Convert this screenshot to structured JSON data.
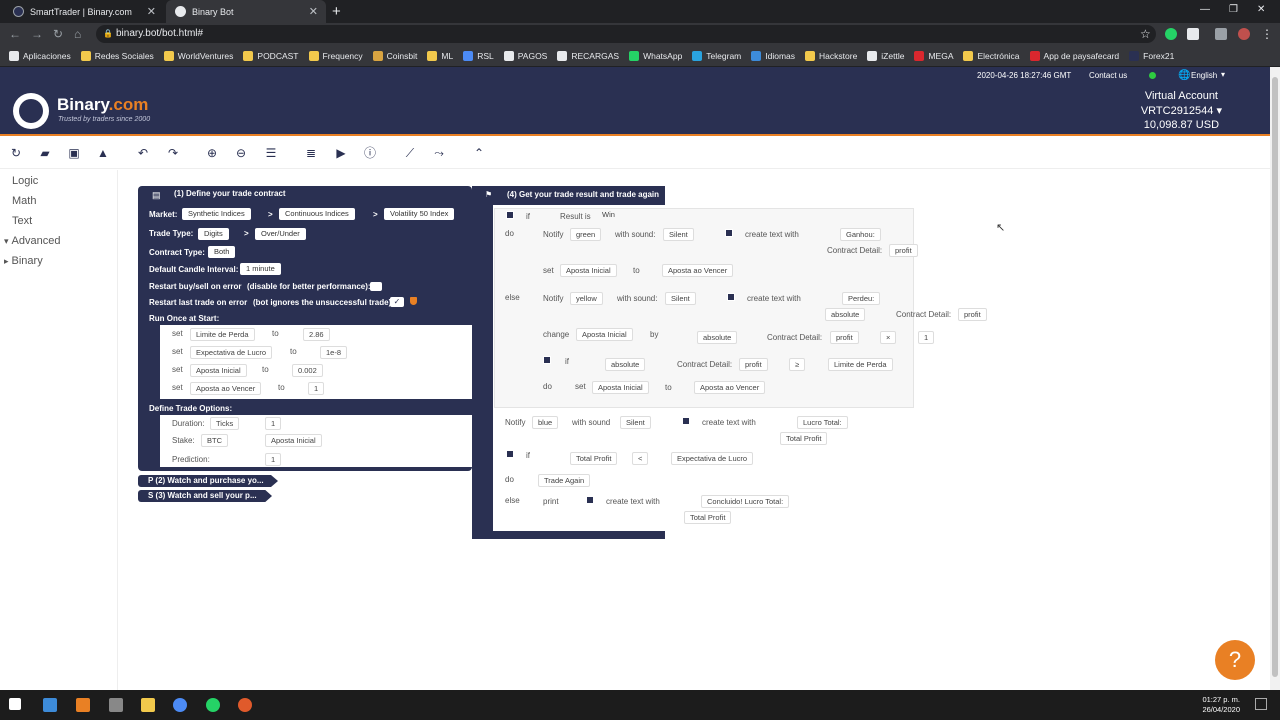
{
  "browser": {
    "tabs": [
      {
        "title": "SmartTrader | Binary.com"
      },
      {
        "title": "Binary Bot"
      }
    ],
    "url": "binary.bot/bot.html#",
    "bookmarks": [
      {
        "label": "Aplicaciones",
        "color": "#e8eaed"
      },
      {
        "label": "Redes Sociales",
        "color": "#f2c94c"
      },
      {
        "label": "WorldVentures",
        "color": "#f2c94c"
      },
      {
        "label": "PODCAST",
        "color": "#f2c94c"
      },
      {
        "label": "Frequency",
        "color": "#f2c94c"
      },
      {
        "label": "Coinsbit",
        "color": "#d9a441"
      },
      {
        "label": "ML",
        "color": "#f2c94c"
      },
      {
        "label": "RSL",
        "color": "#4c8bf5"
      },
      {
        "label": "PAGOS",
        "color": "#e8eaed"
      },
      {
        "label": "RECARGAS",
        "color": "#e8eaed"
      },
      {
        "label": "WhatsApp",
        "color": "#25d366"
      },
      {
        "label": "Telegram",
        "color": "#2aa3df"
      },
      {
        "label": "Idiomas",
        "color": "#3d8bd9"
      },
      {
        "label": "Hackstore",
        "color": "#f2c94c"
      },
      {
        "label": "iZettle",
        "color": "#e8eaed"
      },
      {
        "label": "MEGA",
        "color": "#d9272e"
      },
      {
        "label": "Electrónica",
        "color": "#f2c94c"
      },
      {
        "label": "App de paysafecard",
        "color": "#d9272e"
      },
      {
        "label": "Forex21",
        "color": "#2a3052"
      }
    ]
  },
  "site": {
    "datetime": "2020-04-26 18:27:46 GMT",
    "contact": "Contact us",
    "language": "English",
    "brand_name": "Binary",
    "brand_suffix": ".com",
    "tagline": "Trusted by traders since 2000",
    "account_type": "Virtual Account",
    "account_id": "VRTC2912544",
    "balance": "10,098.87 USD",
    "accent": "#e98024",
    "navy": "#2a3052"
  },
  "toolbox": {
    "categories": [
      {
        "label": "Logic",
        "arrow": ""
      },
      {
        "label": "Math",
        "arrow": ""
      },
      {
        "label": "Text",
        "arrow": ""
      },
      {
        "label": "Advanced",
        "arrow": "▾"
      },
      {
        "label": "Binary",
        "arrow": "▸"
      }
    ]
  },
  "toolbar_icons": [
    "reset-icon",
    "folder-icon",
    "save-icon",
    "drive-icon",
    "undo-icon",
    "redo-icon",
    "zoom-in-icon",
    "zoom-out-icon",
    "sort-icon",
    "list-icon",
    "run-icon",
    "info-icon",
    "chart-icon",
    "tradingview-icon",
    "collapse-icon"
  ],
  "block1": {
    "title": "(1) Define your trade contract",
    "market_label": "Market:",
    "market": [
      "Synthetic Indices",
      "Continuous Indices",
      "Volatility 50 Index"
    ],
    "trade_type_label": "Trade Type:",
    "trade_type": [
      "Digits",
      "Over/Under"
    ],
    "contract_type_label": "Contract Type:",
    "contract_type": "Both",
    "candle_label": "Default Candle Interval:",
    "candle": "1 minute",
    "restart_buy": "Restart buy/sell on error",
    "restart_buy_note": "(disable for better performance):",
    "restart_trade": "Restart last trade on error",
    "restart_trade_note": "(bot ignores the unsuccessful trade):",
    "run_once": "Run Once at Start:",
    "vars": [
      {
        "name": "Limite de Perda",
        "value": "2.86"
      },
      {
        "name": "Expectativa de Lucro",
        "value": "1e-8"
      },
      {
        "name": "Aposta Inicial",
        "value": "0.002"
      },
      {
        "name": "Aposta ao Vencer",
        "value": "1"
      }
    ],
    "set_word": "set",
    "to_word": "to",
    "options": "Define Trade Options:",
    "duration_label": "Duration:",
    "duration_unit": "Ticks",
    "duration_value": "1",
    "stake_label": "Stake:",
    "stake_currency": "BTC",
    "stake_var": "Aposta Inicial",
    "prediction_label": "Prediction:",
    "prediction_value": "1"
  },
  "block2": {
    "title": "P (2) Watch and purchase yo..."
  },
  "block3": {
    "title": "S (3) Watch and sell your p..."
  },
  "block4": {
    "title": "(4) Get your trade result and trade again",
    "if_word": "if",
    "do_word": "do",
    "else_word": "else",
    "result_is": "Result is",
    "win": "Win",
    "notify": "Notify",
    "with_sound": "with sound:",
    "with_sound2": "with sound",
    "silent": "Silent",
    "create_text": "create text with",
    "green": "green",
    "yellow": "yellow",
    "blue": "blue",
    "ganhou": "Ganhou:",
    "perdeu": "Perdeu:",
    "contract_detail": "Contract Detail:",
    "profit": "profit",
    "absolute": "absolute",
    "set_word": "set",
    "to_word": "to",
    "by_word": "by",
    "change_word": "change",
    "aposta_inicial": "Aposta Inicial",
    "aposta_vencer": "Aposta ao Vencer",
    "limite_perda": "Limite de Perda",
    "times": "×",
    "gte": "≥",
    "lt": "<",
    "one": "1",
    "lucro_total": "Lucro Total:",
    "total_profit": "Total Profit",
    "expectativa": "Expectativa de Lucro",
    "trade_again": "Trade Again",
    "print": "print",
    "concluido": "Concluido! Lucro Total:"
  },
  "help_icon": "?",
  "taskbar": {
    "time": "01:27 p. m.",
    "date": "26/04/2020"
  }
}
